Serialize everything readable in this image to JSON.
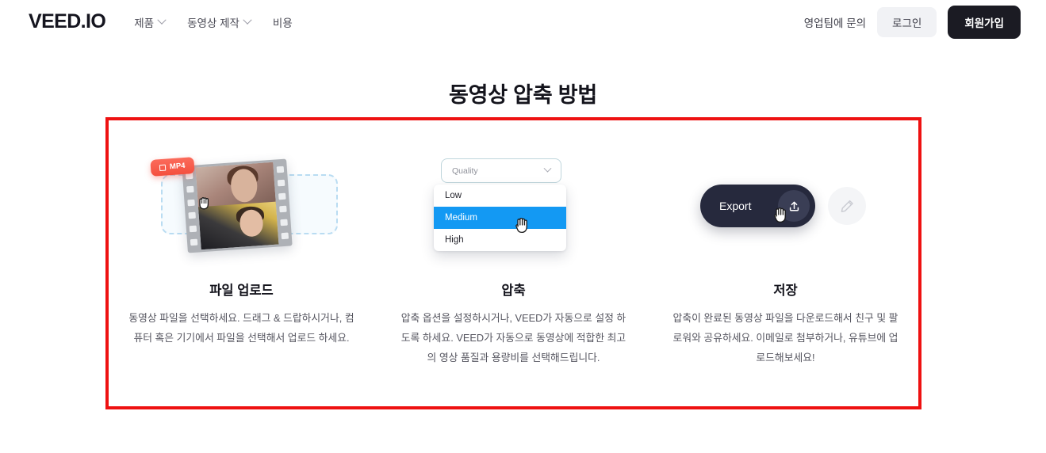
{
  "header": {
    "logo": "VEED.IO",
    "nav": [
      {
        "label": "제품",
        "icon": "chevron-down-icon",
        "has_chevron": true
      },
      {
        "label": "동영상 제작",
        "icon": "chevron-down-icon",
        "has_chevron": true
      },
      {
        "label": "비용",
        "has_chevron": false
      }
    ],
    "contact_label": "영업팀에 문의",
    "login_label": "로그인",
    "signup_label": "회원가입"
  },
  "page_title": "동영상 압축 방법",
  "annotation": {
    "shape": "rectangle-highlight",
    "color": "#ee1111"
  },
  "columns": [
    {
      "title": "파일 업로드",
      "body": "동영상 파일을 선택하세요. 드래그 & 드랍하시거나, 컴퓨터 혹은 기기에서 파일을 선택해서 업로드 하세요.",
      "art": {
        "type": "file-dropzone-filmstrip",
        "badge_label": "MP4",
        "badge_color": "#f4503f",
        "dropzone_border_color": "#b9dcf2",
        "cursor": "grab-cursor"
      }
    },
    {
      "title": "압축",
      "body": "압축 옵션을 설정하시거나, VEED가 자동으로 설정 하도록 하세요. VEED가 자동으로 동영상에 적합한 최고의 영상 품질과 용량비를 선택해드립니다.",
      "art": {
        "type": "quality-dropdown",
        "select_placeholder": "Quality",
        "options": [
          "Low",
          "Medium",
          "High"
        ],
        "selected_option": "Medium",
        "highlight_color": "#1399f3",
        "cursor": "pointer-cursor"
      }
    },
    {
      "title": "저장",
      "body": "압축이 완료된 동영상 파일을 다운로드해서 친구 및 팔로워와 공유하세요. 이메일로 첨부하거나, 유튜브에 업로드해보세요!",
      "art": {
        "type": "export-button",
        "export_label": "Export",
        "export_icon": "upload-icon",
        "export_color": "#26293d",
        "edit_icon": "pencil-icon",
        "cursor": "pointer-cursor"
      }
    }
  ]
}
